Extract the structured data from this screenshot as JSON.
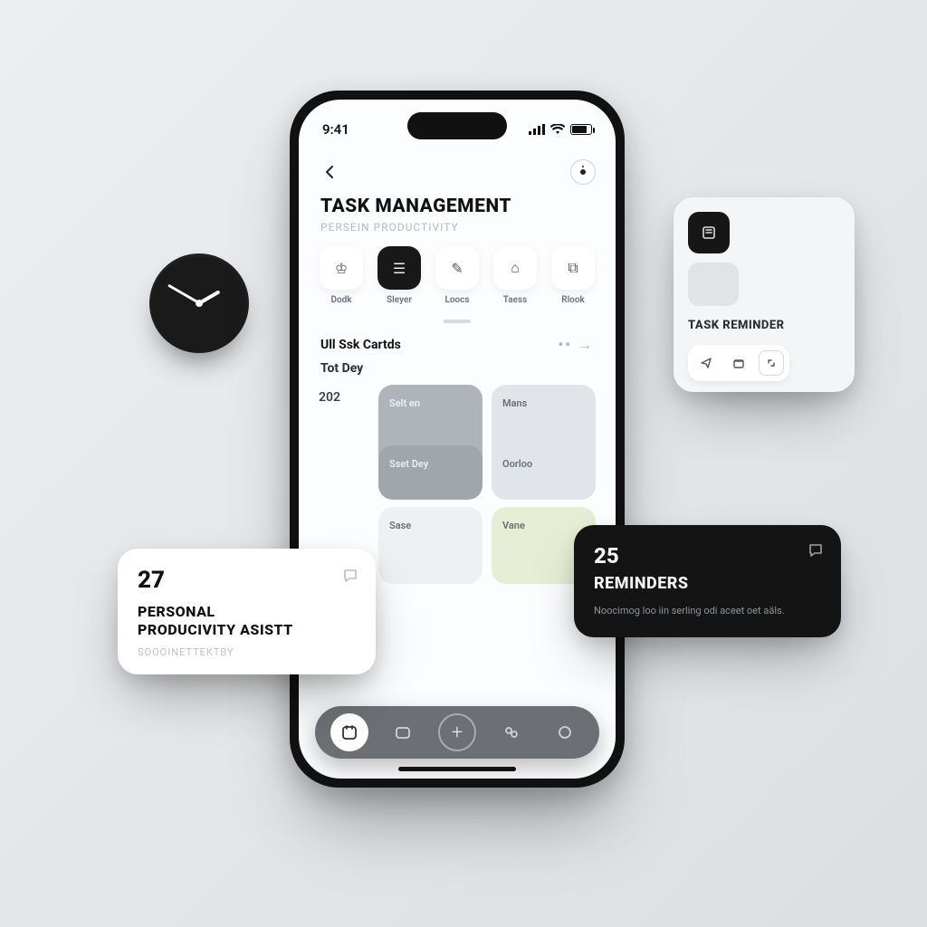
{
  "status": {
    "time": "9:41"
  },
  "header": {
    "title": "TASK MANAGEMENT",
    "subtitle": "PERSEIN PRODUCTIVITY"
  },
  "chips": [
    {
      "label": "Dodk",
      "glyph": "♔",
      "active": false
    },
    {
      "label": "Sleyer",
      "glyph": "☰",
      "active": true
    },
    {
      "label": "Loocs",
      "glyph": "✎",
      "active": false
    },
    {
      "label": "Taess",
      "glyph": "⌂",
      "active": false
    },
    {
      "label": "Rlook",
      "glyph": "⧉",
      "active": false
    }
  ],
  "section": {
    "title": "Ull Ssk Cartds",
    "more": "•• →",
    "subtitle": "Tot Dey"
  },
  "grid": {
    "date1": "202",
    "card1": "Selt en",
    "card2": "Mans",
    "card3": "Sset Dey",
    "card4": "Oorloo",
    "card5": "Sase",
    "card6": "Vane"
  },
  "widgets": {
    "taskReminder": {
      "label": "TASK REMINDER"
    },
    "personal": {
      "count": "27",
      "title_l1": "PERSONAL",
      "title_l2": "PRODUCIVITY ASISTT",
      "subtitle": "SOOOINETTEKTBY"
    },
    "reminders": {
      "count": "25",
      "title": "REMINDERS",
      "subtitle": "Noocimog loo iin serling odi aceet oet aäls."
    }
  }
}
